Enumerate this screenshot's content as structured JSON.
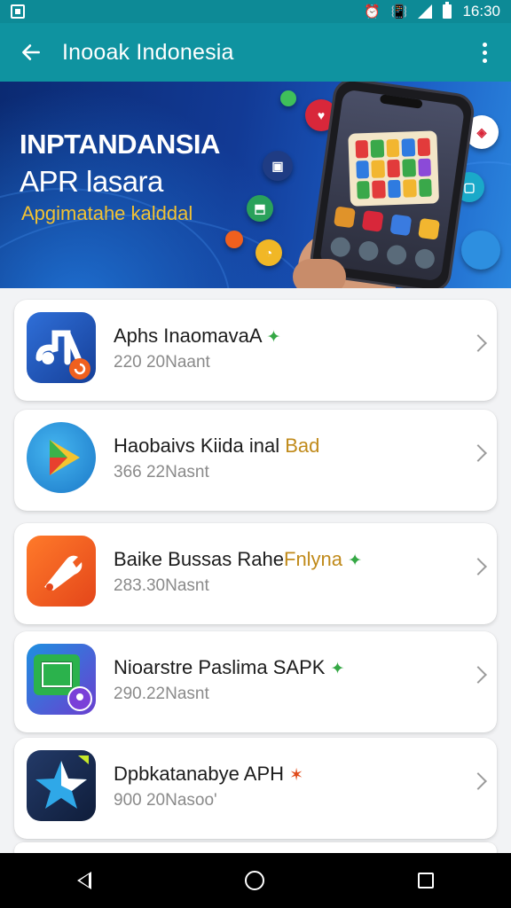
{
  "status_bar": {
    "time": "16:30",
    "icons": [
      "notification-icon",
      "alarm-icon",
      "vibrate-icon",
      "signal-icon",
      "battery-icon"
    ]
  },
  "app_bar": {
    "title": "Inooak Indonesia",
    "back_icon": "arrow-left-icon",
    "menu_icon": "more-vertical-icon"
  },
  "banner": {
    "title_line1": "INPTANDANSIA",
    "title_line2": "APR lasara",
    "subtitle": "Apgimatahe kalddal",
    "colors": {
      "background": "#123a95",
      "subtitle": "#f2c232"
    }
  },
  "apps": [
    {
      "name": "Aphs Inaomava",
      "name_highlight": "A",
      "badge": "star-green-icon",
      "meta": "220 20Naant",
      "icon": "music-note-icon",
      "icon_color": "#1f5bbf"
    },
    {
      "name": "Haobaivs Kiida inal ",
      "name_highlight": "Bad",
      "badge": "",
      "meta": "366 22Nasnt",
      "icon": "play-store-icon",
      "icon_color": "#2a9be0"
    },
    {
      "name": "Baike Bussas Rahe",
      "name_highlight": "Fnlyna",
      "badge": "star-green-icon",
      "meta": "283.30Nasnt",
      "icon": "tools-icon",
      "icon_color": "#f0601e"
    },
    {
      "name": "Nioarstre Paslima SAPK",
      "name_highlight": "",
      "badge": "star-green-icon",
      "meta": "290.22Nasnt",
      "icon": "screen-icon",
      "icon_color": "#1a7fd6"
    },
    {
      "name": "Dpbkatanabye APH",
      "name_highlight": "",
      "badge": "star-red-icon",
      "meta": "900 20Nasoo'",
      "icon": "star-app-icon",
      "icon_color": "#172b4d"
    }
  ],
  "nav_bar": {
    "back": "nav-back-icon",
    "home": "nav-home-icon",
    "recent": "nav-recent-icon"
  }
}
